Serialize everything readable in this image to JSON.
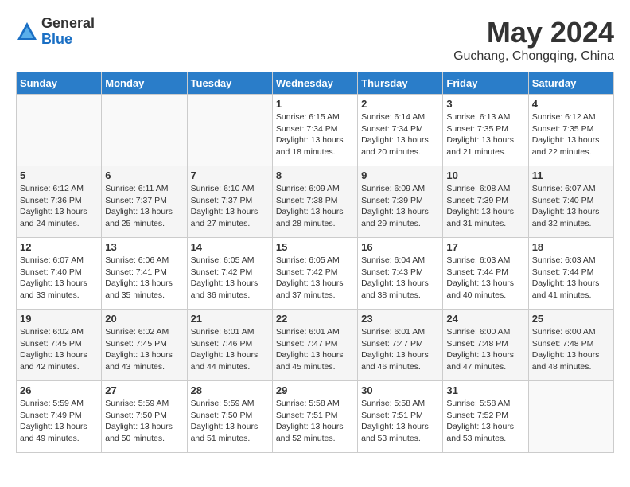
{
  "logo": {
    "general": "General",
    "blue": "Blue"
  },
  "title": "May 2024",
  "location": "Guchang, Chongqing, China",
  "days_of_week": [
    "Sunday",
    "Monday",
    "Tuesday",
    "Wednesday",
    "Thursday",
    "Friday",
    "Saturday"
  ],
  "weeks": [
    [
      {
        "day": "",
        "sunrise": "",
        "sunset": "",
        "daylight": ""
      },
      {
        "day": "",
        "sunrise": "",
        "sunset": "",
        "daylight": ""
      },
      {
        "day": "",
        "sunrise": "",
        "sunset": "",
        "daylight": ""
      },
      {
        "day": "1",
        "sunrise": "Sunrise: 6:15 AM",
        "sunset": "Sunset: 7:34 PM",
        "daylight": "Daylight: 13 hours and 18 minutes."
      },
      {
        "day": "2",
        "sunrise": "Sunrise: 6:14 AM",
        "sunset": "Sunset: 7:34 PM",
        "daylight": "Daylight: 13 hours and 20 minutes."
      },
      {
        "day": "3",
        "sunrise": "Sunrise: 6:13 AM",
        "sunset": "Sunset: 7:35 PM",
        "daylight": "Daylight: 13 hours and 21 minutes."
      },
      {
        "day": "4",
        "sunrise": "Sunrise: 6:12 AM",
        "sunset": "Sunset: 7:35 PM",
        "daylight": "Daylight: 13 hours and 22 minutes."
      }
    ],
    [
      {
        "day": "5",
        "sunrise": "Sunrise: 6:12 AM",
        "sunset": "Sunset: 7:36 PM",
        "daylight": "Daylight: 13 hours and 24 minutes."
      },
      {
        "day": "6",
        "sunrise": "Sunrise: 6:11 AM",
        "sunset": "Sunset: 7:37 PM",
        "daylight": "Daylight: 13 hours and 25 minutes."
      },
      {
        "day": "7",
        "sunrise": "Sunrise: 6:10 AM",
        "sunset": "Sunset: 7:37 PM",
        "daylight": "Daylight: 13 hours and 27 minutes."
      },
      {
        "day": "8",
        "sunrise": "Sunrise: 6:09 AM",
        "sunset": "Sunset: 7:38 PM",
        "daylight": "Daylight: 13 hours and 28 minutes."
      },
      {
        "day": "9",
        "sunrise": "Sunrise: 6:09 AM",
        "sunset": "Sunset: 7:39 PM",
        "daylight": "Daylight: 13 hours and 29 minutes."
      },
      {
        "day": "10",
        "sunrise": "Sunrise: 6:08 AM",
        "sunset": "Sunset: 7:39 PM",
        "daylight": "Daylight: 13 hours and 31 minutes."
      },
      {
        "day": "11",
        "sunrise": "Sunrise: 6:07 AM",
        "sunset": "Sunset: 7:40 PM",
        "daylight": "Daylight: 13 hours and 32 minutes."
      }
    ],
    [
      {
        "day": "12",
        "sunrise": "Sunrise: 6:07 AM",
        "sunset": "Sunset: 7:40 PM",
        "daylight": "Daylight: 13 hours and 33 minutes."
      },
      {
        "day": "13",
        "sunrise": "Sunrise: 6:06 AM",
        "sunset": "Sunset: 7:41 PM",
        "daylight": "Daylight: 13 hours and 35 minutes."
      },
      {
        "day": "14",
        "sunrise": "Sunrise: 6:05 AM",
        "sunset": "Sunset: 7:42 PM",
        "daylight": "Daylight: 13 hours and 36 minutes."
      },
      {
        "day": "15",
        "sunrise": "Sunrise: 6:05 AM",
        "sunset": "Sunset: 7:42 PM",
        "daylight": "Daylight: 13 hours and 37 minutes."
      },
      {
        "day": "16",
        "sunrise": "Sunrise: 6:04 AM",
        "sunset": "Sunset: 7:43 PM",
        "daylight": "Daylight: 13 hours and 38 minutes."
      },
      {
        "day": "17",
        "sunrise": "Sunrise: 6:03 AM",
        "sunset": "Sunset: 7:44 PM",
        "daylight": "Daylight: 13 hours and 40 minutes."
      },
      {
        "day": "18",
        "sunrise": "Sunrise: 6:03 AM",
        "sunset": "Sunset: 7:44 PM",
        "daylight": "Daylight: 13 hours and 41 minutes."
      }
    ],
    [
      {
        "day": "19",
        "sunrise": "Sunrise: 6:02 AM",
        "sunset": "Sunset: 7:45 PM",
        "daylight": "Daylight: 13 hours and 42 minutes."
      },
      {
        "day": "20",
        "sunrise": "Sunrise: 6:02 AM",
        "sunset": "Sunset: 7:45 PM",
        "daylight": "Daylight: 13 hours and 43 minutes."
      },
      {
        "day": "21",
        "sunrise": "Sunrise: 6:01 AM",
        "sunset": "Sunset: 7:46 PM",
        "daylight": "Daylight: 13 hours and 44 minutes."
      },
      {
        "day": "22",
        "sunrise": "Sunrise: 6:01 AM",
        "sunset": "Sunset: 7:47 PM",
        "daylight": "Daylight: 13 hours and 45 minutes."
      },
      {
        "day": "23",
        "sunrise": "Sunrise: 6:01 AM",
        "sunset": "Sunset: 7:47 PM",
        "daylight": "Daylight: 13 hours and 46 minutes."
      },
      {
        "day": "24",
        "sunrise": "Sunrise: 6:00 AM",
        "sunset": "Sunset: 7:48 PM",
        "daylight": "Daylight: 13 hours and 47 minutes."
      },
      {
        "day": "25",
        "sunrise": "Sunrise: 6:00 AM",
        "sunset": "Sunset: 7:48 PM",
        "daylight": "Daylight: 13 hours and 48 minutes."
      }
    ],
    [
      {
        "day": "26",
        "sunrise": "Sunrise: 5:59 AM",
        "sunset": "Sunset: 7:49 PM",
        "daylight": "Daylight: 13 hours and 49 minutes."
      },
      {
        "day": "27",
        "sunrise": "Sunrise: 5:59 AM",
        "sunset": "Sunset: 7:50 PM",
        "daylight": "Daylight: 13 hours and 50 minutes."
      },
      {
        "day": "28",
        "sunrise": "Sunrise: 5:59 AM",
        "sunset": "Sunset: 7:50 PM",
        "daylight": "Daylight: 13 hours and 51 minutes."
      },
      {
        "day": "29",
        "sunrise": "Sunrise: 5:58 AM",
        "sunset": "Sunset: 7:51 PM",
        "daylight": "Daylight: 13 hours and 52 minutes."
      },
      {
        "day": "30",
        "sunrise": "Sunrise: 5:58 AM",
        "sunset": "Sunset: 7:51 PM",
        "daylight": "Daylight: 13 hours and 53 minutes."
      },
      {
        "day": "31",
        "sunrise": "Sunrise: 5:58 AM",
        "sunset": "Sunset: 7:52 PM",
        "daylight": "Daylight: 13 hours and 53 minutes."
      },
      {
        "day": "",
        "sunrise": "",
        "sunset": "",
        "daylight": ""
      }
    ]
  ]
}
